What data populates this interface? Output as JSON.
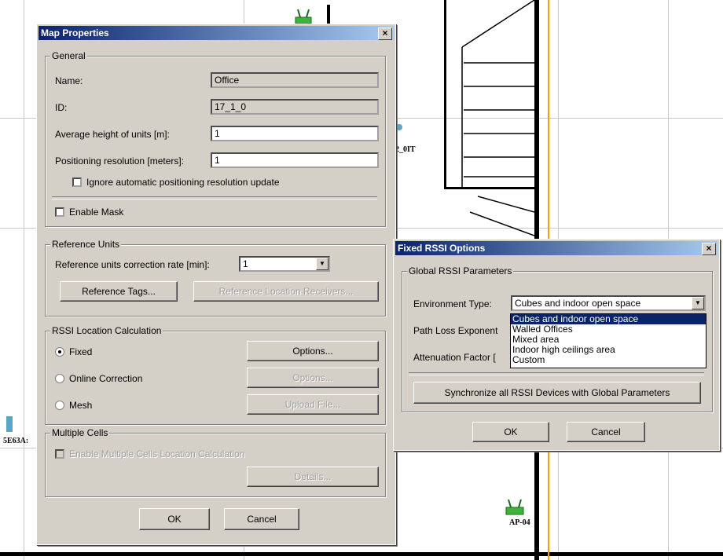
{
  "map": {
    "labels": [
      "2_0IT",
      "5E63A:",
      "AP-04"
    ],
    "icons": [
      "access-point-icon",
      "access-point-icon"
    ]
  },
  "map_properties": {
    "title": "Map Properties",
    "close_glyph": "×",
    "general": {
      "title": "General",
      "name_label": "Name:",
      "name_value": "Office",
      "id_label": "ID:",
      "id_value": "17_1_0",
      "avg_height_label": "Average height of units [m]:",
      "avg_height_value": "1",
      "pos_res_label": "Positioning resolution [meters]:",
      "pos_res_value": "1",
      "ignore_auto_label": "Ignore automatic positioning resolution update",
      "enable_mask_label": "Enable Mask"
    },
    "reference_units": {
      "title": "Reference Units",
      "correction_rate_label": "Reference units correction rate [min]:",
      "correction_rate_value": "1",
      "ref_tags_button": "Reference Tags...",
      "ref_receivers_button": "Reference Location Receivers..."
    },
    "rssi": {
      "title": "RSSI Location Calculation",
      "fixed_label": "Fixed",
      "online_label": "Online Correction",
      "mesh_label": "Mesh",
      "options_button": "Options...",
      "options_disabled_button": "Options...",
      "upload_button": "Upload File...",
      "selected": "Fixed"
    },
    "multiple_cells": {
      "title": "Multiple Cells",
      "enable_label": "Enable Multiple Cells Location Calculation",
      "details_button": "Details..."
    },
    "ok_button": "OK",
    "cancel_button": "Cancel"
  },
  "fixed_rssi": {
    "title": "Fixed RSSI Options",
    "close_glyph": "×",
    "group_title": "Global RSSI Parameters",
    "env_type_label": "Environment Type:",
    "env_type_value": "Cubes and indoor open space",
    "path_loss_label": "Path Loss Exponent",
    "attenuation_label": "Attenuation Factor [",
    "dropdown_options": [
      "Cubes and indoor open space",
      "Walled Offices",
      "Mixed area",
      "Indoor high ceilings area",
      "Custom"
    ],
    "sync_button": "Synchronize all RSSI Devices with Global Parameters",
    "ok_button": "OK",
    "cancel_button": "Cancel"
  },
  "colors": {
    "title_start": "#0a246a",
    "title_end": "#a6caf0",
    "dialog_bg": "#d4d0c8",
    "orange_line": "#f5a000",
    "ap_green": "#3cb43c"
  }
}
